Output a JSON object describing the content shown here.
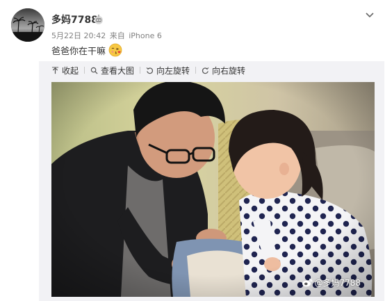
{
  "post": {
    "author": "多妈7788",
    "date": "5月22日 20:42",
    "source_prefix": "来自",
    "source": "iPhone 6",
    "text": "爸爸你在干嘛"
  },
  "toolbar": {
    "collapse_label": "收起",
    "view_large_label": "查看大图",
    "rotate_left_label": "向左旋转",
    "rotate_right_label": "向右旋转"
  },
  "photo": {
    "watermark": "@多妈7788"
  },
  "icons": {
    "badge": "robot-badge-icon",
    "menu": "chevron-down-icon",
    "emoji": "kiss-face-emoji",
    "collapse": "arrow-up-icon",
    "view_large": "magnifier-icon",
    "rotate_left": "rotate-left-icon",
    "rotate_right": "rotate-right-icon",
    "watermark_logo": "weibo-logo-icon"
  },
  "colors": {
    "text": "#333333",
    "meta": "#808080",
    "panel": "#f2f2f5"
  }
}
